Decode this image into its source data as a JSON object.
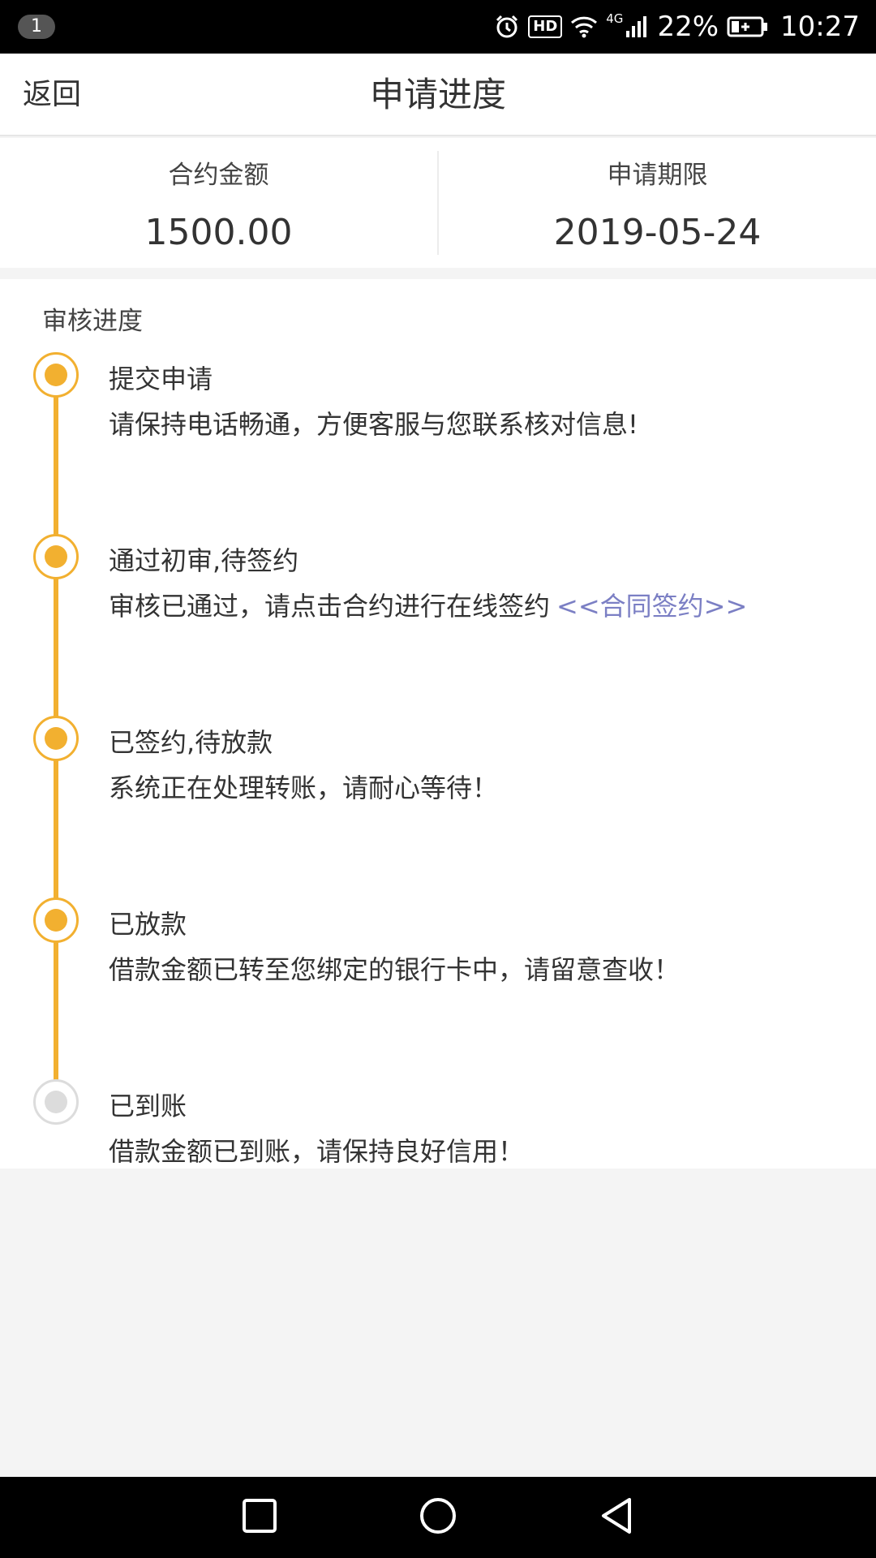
{
  "status_bar": {
    "notification_count": "1",
    "icons": [
      "alarm-icon",
      "hd-icon",
      "wifi-icon",
      "signal-icon",
      "battery-icon"
    ],
    "hd_label": "HD",
    "network_label": "4G",
    "battery_percent": "22%",
    "time": "10:27"
  },
  "header": {
    "back_label": "返回",
    "title": "申请进度"
  },
  "summary": {
    "amount_label": "合约金额",
    "amount_value": "1500.00",
    "term_label": "申请期限",
    "term_value": "2019-05-24"
  },
  "progress": {
    "section_title": "审核进度",
    "steps": [
      {
        "title": "提交申请",
        "desc": "请保持电话畅通，方便客服与您联系核对信息!",
        "done": true
      },
      {
        "title": "通过初审,待签约",
        "desc": "审核已通过，请点击合约进行在线签约",
        "link": "<<合同签约>>",
        "done": true
      },
      {
        "title": "已签约,待放款",
        "desc": "系统正在处理转账，请耐心等待！",
        "done": true
      },
      {
        "title": "已放款",
        "desc": "借款金额已转至您绑定的银行卡中，请留意查收！",
        "done": true
      },
      {
        "title": "已到账",
        "desc": "借款金额已到账，请保持良好信用！",
        "done": false
      }
    ]
  },
  "colors": {
    "accent": "#f2b030",
    "pending": "#dcdcdc",
    "link": "#7b7fc4",
    "background": "#f4f4f4"
  },
  "nav_keys": [
    "recents-square-icon",
    "home-circle-icon",
    "back-triangle-icon"
  ]
}
